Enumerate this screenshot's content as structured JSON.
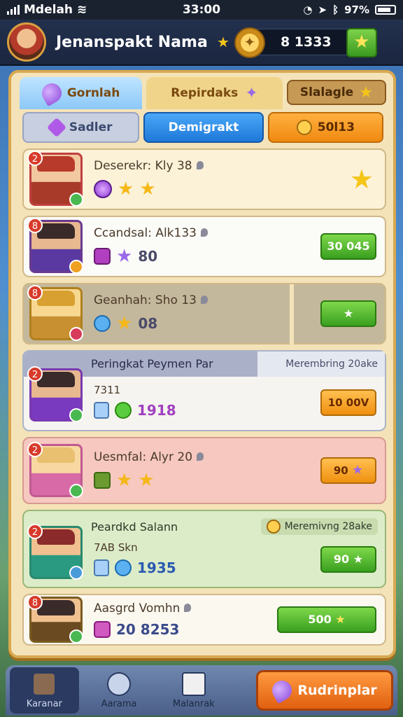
{
  "status": {
    "carrier": "Mdelah",
    "time": "33:00",
    "battery": "97%"
  },
  "header": {
    "player_name": "Jenanspakt Nama",
    "coins": "8 1333"
  },
  "tabs": [
    {
      "label": "Gornlah"
    },
    {
      "label": "Repirdaks"
    },
    {
      "label": "Slalagle"
    }
  ],
  "filters": [
    {
      "label": "Sadler"
    },
    {
      "label": "Demigrakt"
    },
    {
      "label": "50l13"
    }
  ],
  "rows": [
    {
      "name": "Deserekr: Kly 38",
      "value": "",
      "button": ""
    },
    {
      "name": "Ccandsal: Alk133",
      "value": "80",
      "button": "30 045"
    },
    {
      "name": "Geanhah: Sho 13",
      "value": "08",
      "button": ""
    },
    {
      "head_left": "Peringkat Peymen Par",
      "head_right": "Merembring 20ake",
      "sub": "7311",
      "value": "1918",
      "button": "10 00V"
    },
    {
      "name": "Uesmfal: Alyr 20",
      "value": "",
      "button": "90"
    },
    {
      "head_left": "Peardkd Salann",
      "head_right": "Meremivng 28ake",
      "sub": "7AB Skn",
      "value": "1935",
      "button": "90"
    },
    {
      "name": "Aasgrd Vomhn",
      "value": "20 8253",
      "button": "500"
    }
  ],
  "bottom_nav": [
    {
      "label": "Karanar"
    },
    {
      "label": "Aarama"
    },
    {
      "label": "Malanrak"
    }
  ],
  "bottom_action": {
    "label": "Rudrinplar"
  },
  "colors": {
    "panel_bg": "#f4e3b8",
    "accent_green": "#3aa020",
    "accent_orange": "#f09010",
    "accent_blue": "#1e78d8"
  }
}
